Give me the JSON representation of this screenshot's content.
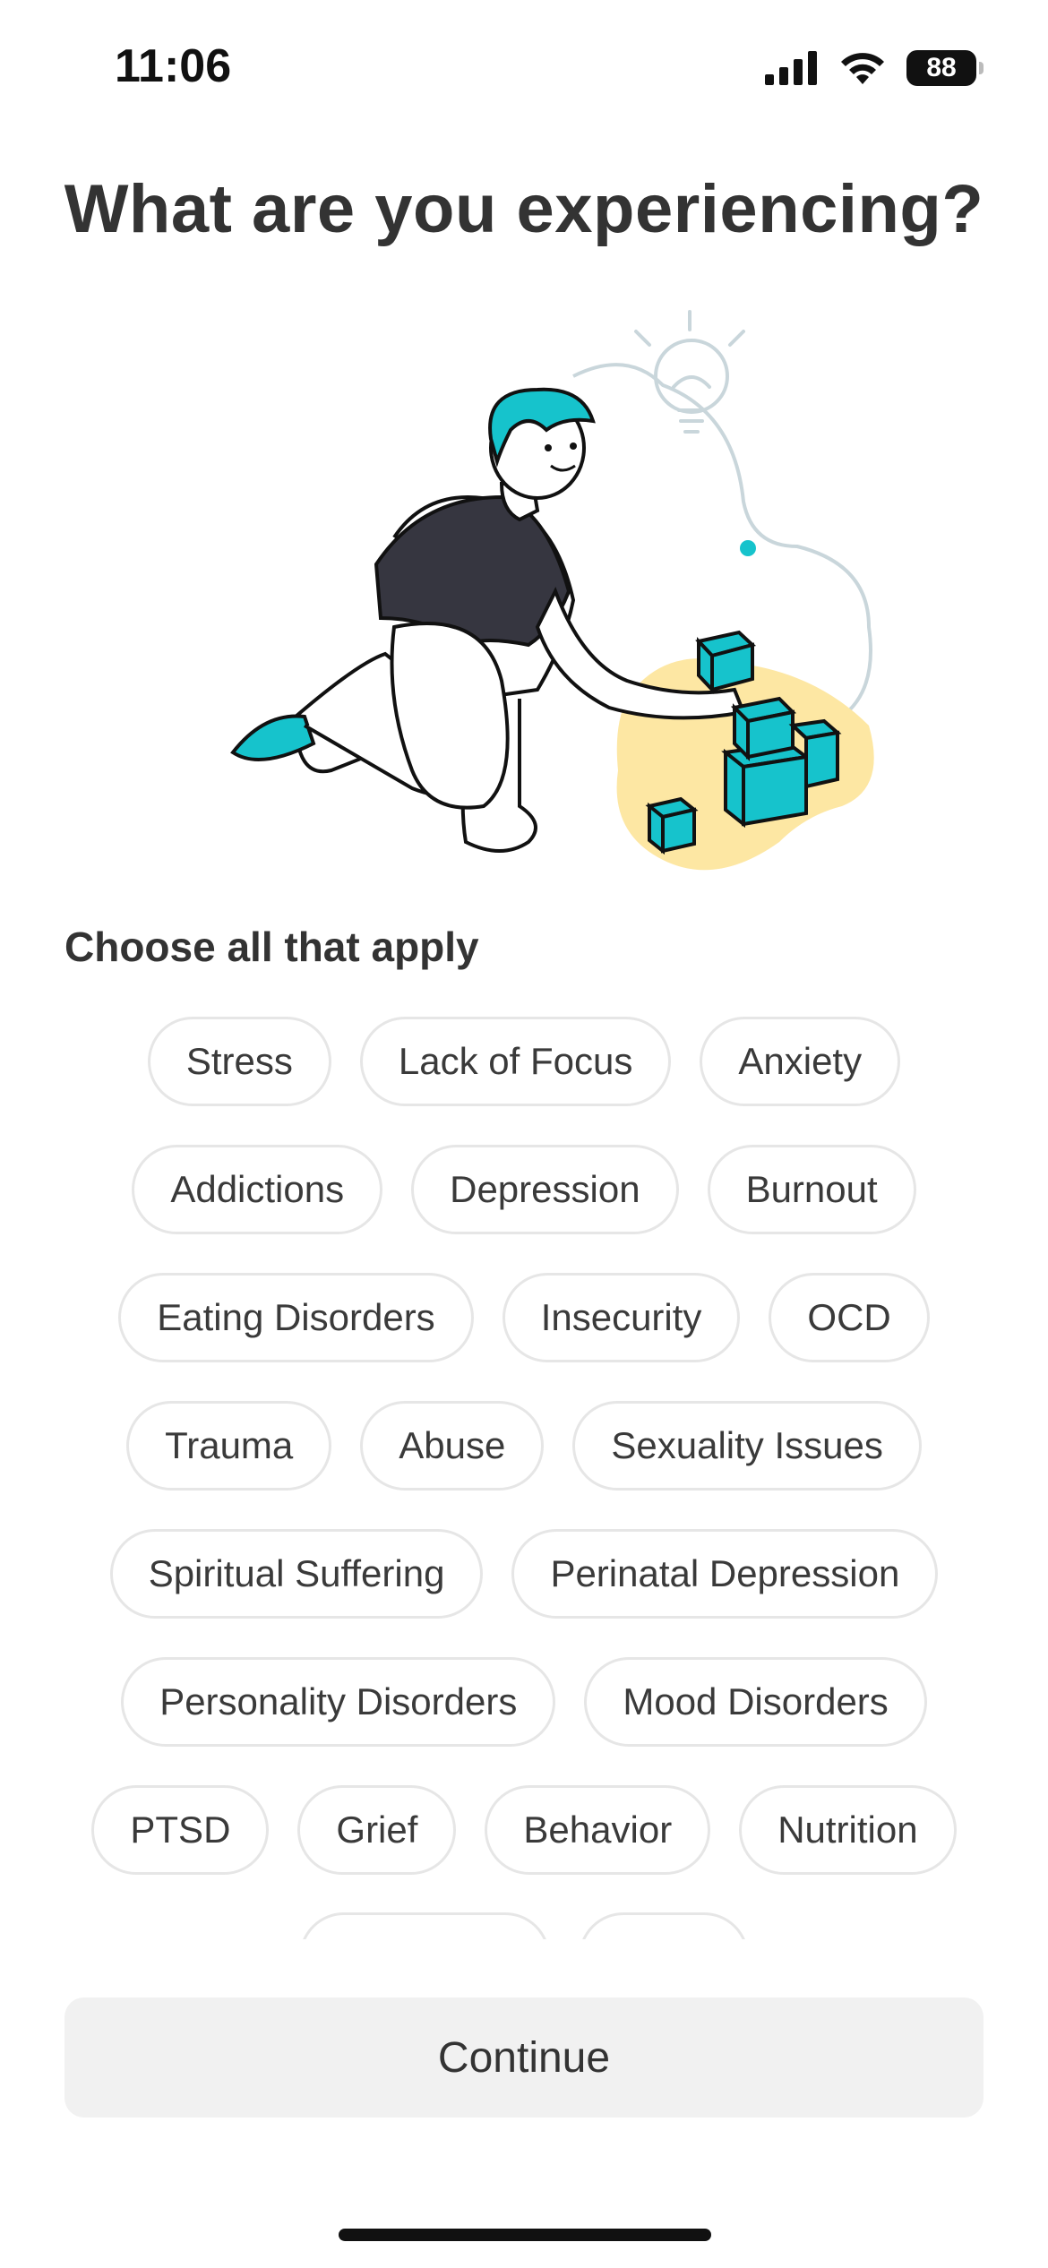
{
  "status_bar": {
    "time": "11:06",
    "battery": "88",
    "icons": [
      "signal-icon",
      "wifi-icon",
      "battery-icon"
    ]
  },
  "title": "What are you experiencing?",
  "illustration": {
    "icon": "person-stacking-blocks-illustration",
    "accent_color": "#16c3cc",
    "blob_color": "#fde7a3",
    "dark_color": "#363640"
  },
  "section_label": "Choose all that apply",
  "chip_rows": [
    [
      "Stress",
      "Lack of Focus",
      "Anxiety"
    ],
    [
      "Addictions",
      "Depression",
      "Burnout"
    ],
    [
      "Eating Disorders",
      "Insecurity",
      "OCD"
    ],
    [
      "Trauma",
      "Abuse",
      "Sexuality Issues"
    ],
    [
      "Spiritual Suffering",
      "Perinatal Depression"
    ],
    [
      "Personality Disorders",
      "Mood Disorders"
    ],
    [
      "PTSD",
      "Grief",
      "Behavior",
      "Nutrition"
    ]
  ],
  "continue_label": "Continue",
  "colors": {
    "chip_border": "#e6e6e6",
    "button_bg": "#f1f1f1",
    "text": "#333333"
  }
}
